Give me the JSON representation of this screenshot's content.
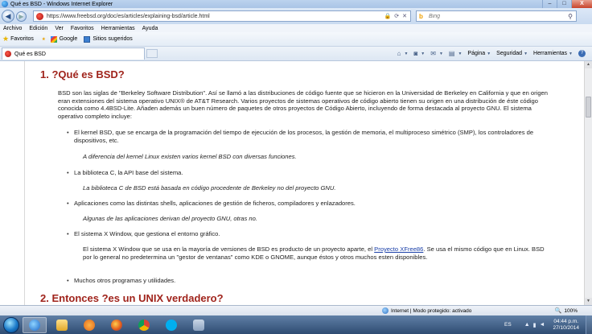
{
  "window": {
    "title": "Qué es BSD - Windows Internet Explorer",
    "buttons": {
      "minimize": "–",
      "maximize": "□",
      "close": "X"
    }
  },
  "address_bar": {
    "url": "https://www.freebsd.org/doc/es/articles/explaining-bsd/article.html",
    "search_placeholder": "Bing"
  },
  "menu": [
    "Archivo",
    "Edición",
    "Ver",
    "Favoritos",
    "Herramientas",
    "Ayuda"
  ],
  "favorites_bar": {
    "label": "Favoritos",
    "links": [
      "Google",
      "Sitios sugeridos"
    ]
  },
  "tab": {
    "label": "Qué es BSD"
  },
  "command_bar": {
    "page": "Página",
    "safety": "Seguridad",
    "tools": "Herramientas"
  },
  "article": {
    "heading1": "1. ?Qué es BSD?",
    "intro": "BSD son las siglas de \"Berkeley Software Distribution\". Así se llamó a las distribuciones de código fuente que se hicieron en la Universidad de Berkeley en California y que en origen eran extensiones del sistema operativo UNIX® de AT&T Research. Varios proyectos de sistemas operativos de código abierto tienen su origen en una distribución de éste código conocida como 4.4BSD-Lite. Añaden además un buen número de paquetes de otros proyectos de Código Abierto, incluyendo de forma destacada al proyecto GNU. El sistema operativo completo incluye:",
    "items": [
      {
        "text": "El kernel BSD, que se encarga de la programación del tiempo de ejecución de los procesos, la gestión de memoria, el multiproceso simétrico (SMP), los controladores de dispositivos, etc.",
        "note": "A diferencia del kernel Linux existen varios kernel BSD con diversas funciones."
      },
      {
        "text": "La biblioteca C, la API base del sistema.",
        "note": "La biblioteca C de BSD está basada en código procedente de Berkeley no del proyecto GNU."
      },
      {
        "text": "Aplicaciones como las distintas shells, aplicaciones de gestión de ficheros, compiladores y enlazadores.",
        "note": "Algunas de las aplicaciones derivan del proyecto GNU, otras no."
      },
      {
        "text": "El sistema X Window, que gestiona el entorno gráfico.",
        "note_before_link": "El sistema X Window que se usa en la mayoría de versiones de BSD es producto de un proyecto aparte, el ",
        "note_link": "Proyecto XFree86",
        "note_after_link": ". Se usa el mismo código que en Linux. BSD por lo general no predetermina un \"gestor de ventanas\" como KDE o GNOME, aunque éstos y otros muchos esten disponibles."
      },
      {
        "text": "Muchos otros programas y utilidades."
      }
    ],
    "heading2": "2. Entonces ?es un UNIX verdadero?"
  },
  "status_bar": {
    "zone": "Internet | Modo protegido: activado",
    "zoom": "100%"
  },
  "taskbar": {
    "language": "ES",
    "time": "04:44 p.m.",
    "date": "27/10/2014"
  }
}
